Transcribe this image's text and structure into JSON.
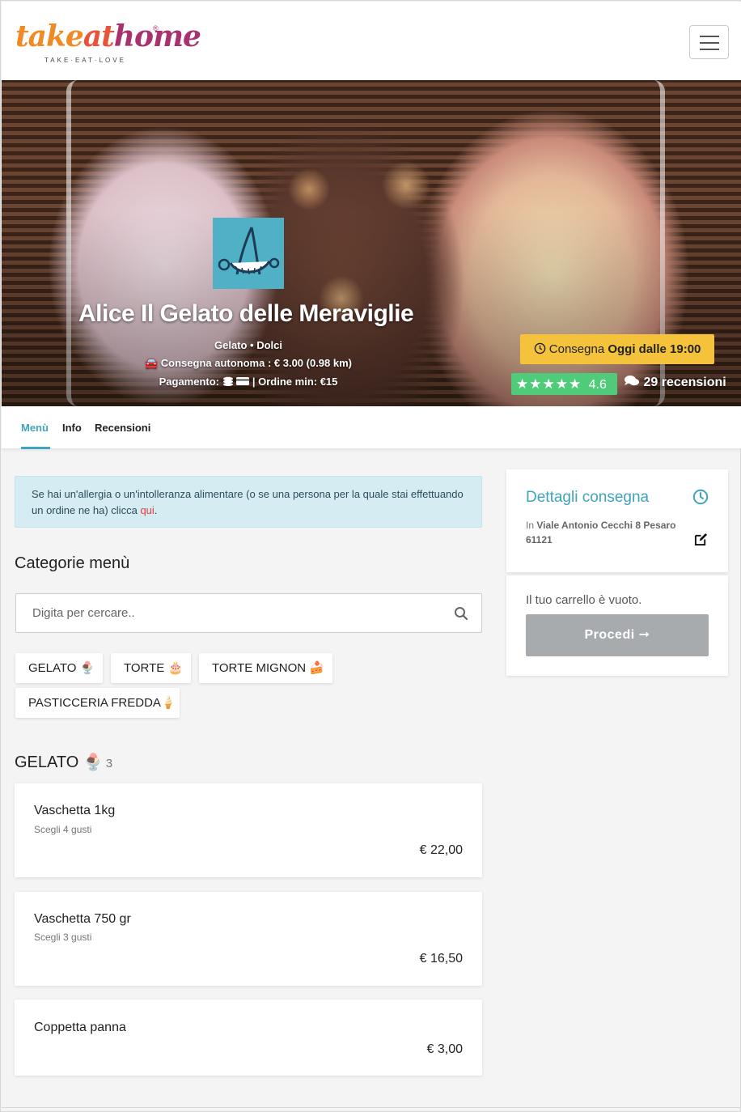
{
  "brand": {
    "logo_part1": "take",
    "logo_part2": "at",
    "logo_part3": "home",
    "tagline": "TAKE·EAT·LOVE"
  },
  "hero": {
    "restaurant_name": "Alice Il Gelato delle Meraviglie",
    "categories": "Gelato • Dolci",
    "delivery": "🚘 Consegna autonoma : € 3.00 (0.98 km)",
    "payment_label": "Pagamento:",
    "min_order": "| Ordine min: €15",
    "consegna_prefix": "Consegna",
    "consegna_time": "Oggi dalle 19:00",
    "rating_value": "4.6",
    "rating_stars": 5,
    "reviews": "29 recensioni"
  },
  "tabs": [
    {
      "label": "Menù",
      "active": true
    },
    {
      "label": "Info",
      "active": false
    },
    {
      "label": "Recensioni",
      "active": false
    }
  ],
  "allergy": {
    "text": "Se hai un'allergia o un'intolleranza alimentare (o se una persona per la quale stai effettuando un ordine ne ha) clicca",
    "link": "qui",
    "end": "."
  },
  "menu": {
    "categories_heading": "Categorie menù",
    "search_placeholder": "Digita per cercare..",
    "chips": [
      "GELATO 🍨",
      "TORTE 🎂",
      "TORTE MIGNON 🍰",
      "PASTICCERIA FREDDA🍦"
    ],
    "section": {
      "title": "GELATO 🍨",
      "count": "3",
      "items": [
        {
          "name": "Vaschetta 1kg",
          "desc": "Scegli 4 gusti",
          "price": "€ 22,00"
        },
        {
          "name": "Vaschetta 750 gr",
          "desc": "Scegli 3 gusti",
          "price": "€ 16,50"
        },
        {
          "name": "Coppetta panna",
          "desc": "",
          "price": "€ 3,00"
        }
      ]
    }
  },
  "sidebar": {
    "delivery_title": "Dettagli consegna",
    "address_prefix": "In",
    "address": "Viale Antonio Cecchi 8 Pesaro 61121",
    "cart_empty": "Il tuo carrello è vuoto.",
    "proceed": "Procedi ➞"
  },
  "colors": {
    "accent": "#3fa4bd",
    "consegna_bg": "#f5c33b",
    "rating_bg": "#4fcb7a",
    "allergy_bg": "#d5ecf3",
    "link_red": "#e53b3b",
    "proceed_bg": "#a8abae"
  }
}
